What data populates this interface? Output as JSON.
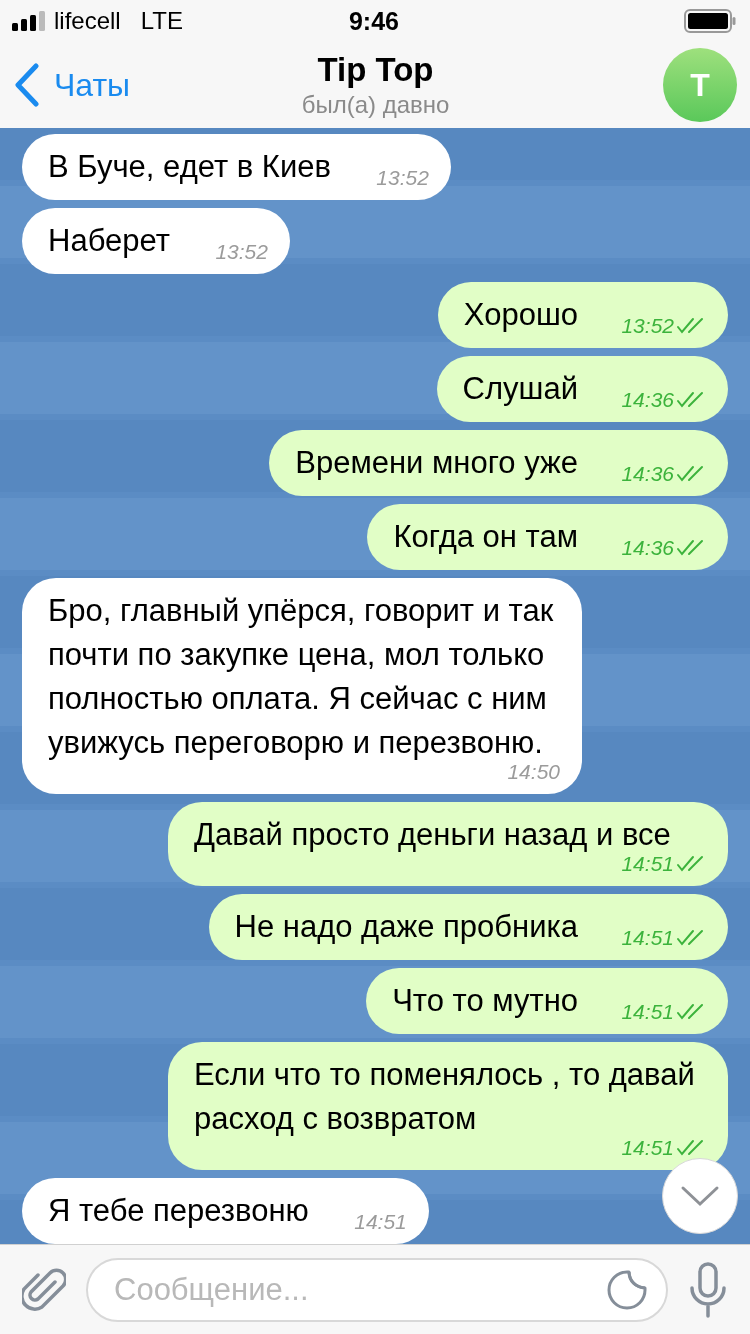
{
  "status_bar": {
    "carrier": "lifecell",
    "network": "LTE",
    "time": "9:46"
  },
  "header": {
    "back_label": "Чаты",
    "title": "Tip Top",
    "subtitle": "был(а) давно",
    "avatar_letter": "T"
  },
  "messages": [
    {
      "kind": "in",
      "text": "В Буче, едет в Киев",
      "time": "13:52"
    },
    {
      "kind": "in",
      "text": "Наберет",
      "time": "13:52"
    },
    {
      "kind": "out",
      "text": "Хорошо",
      "time": "13:52",
      "read": true
    },
    {
      "kind": "out",
      "text": "Слушай",
      "time": "14:36",
      "read": true
    },
    {
      "kind": "out",
      "text": "Времени много уже",
      "time": "14:36",
      "read": true
    },
    {
      "kind": "out",
      "text": "Когда он там",
      "time": "14:36",
      "read": true
    },
    {
      "kind": "in",
      "text": "Бро, главный упёрся, говорит и так почти по закупке цена, мол только полностью оплата. Я сейчас с ним увижусь переговорю и перезвоню.",
      "time": "14:50"
    },
    {
      "kind": "out",
      "text": "Давай просто деньги назад и все",
      "time": "14:51",
      "read": true
    },
    {
      "kind": "out",
      "text": "Не надо даже пробника",
      "time": "14:51",
      "read": true
    },
    {
      "kind": "out",
      "text": "Что то мутно",
      "time": "14:51",
      "read": true
    },
    {
      "kind": "out",
      "text": "Если что то поменялось , то давай расход с возвратом",
      "time": "14:51",
      "read": true
    },
    {
      "kind": "in",
      "text": "Я тебе перезвоню",
      "time": "14:51"
    }
  ],
  "composer": {
    "placeholder": "Сообщение..."
  }
}
